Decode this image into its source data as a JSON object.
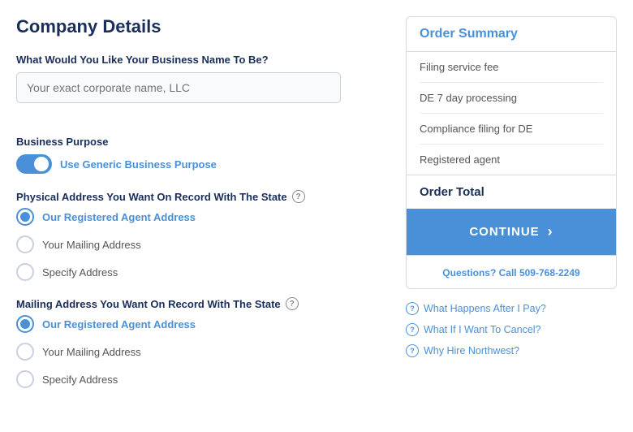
{
  "page": {
    "title": "Company Details"
  },
  "left": {
    "business_name_section": {
      "label": "What Would You Like Your Business Name To Be?",
      "placeholder": "Your exact corporate name, LLC"
    },
    "business_purpose": {
      "label": "Business Purpose",
      "toggle_label": "Use Generic Business Purpose",
      "toggle_on": true
    },
    "physical_address": {
      "label": "Physical Address You Want On Record With The State",
      "has_help": true,
      "options": [
        {
          "label": "Our Registered Agent Address",
          "selected": true
        },
        {
          "label": "Your Mailing Address",
          "selected": false
        },
        {
          "label": "Specify Address",
          "selected": false
        }
      ]
    },
    "mailing_address": {
      "label": "Mailing Address You Want On Record With The State",
      "has_help": true,
      "options": [
        {
          "label": "Our Registered Agent Address",
          "selected": true
        },
        {
          "label": "Your Mailing Address",
          "selected": false
        },
        {
          "label": "Specify Address",
          "selected": false
        }
      ]
    }
  },
  "right": {
    "order_summary": {
      "title": "Order Summary",
      "items": [
        {
          "label": "Filing service fee"
        },
        {
          "label": "DE 7 day processing"
        },
        {
          "label": "Compliance filing for DE"
        },
        {
          "label": "Registered agent"
        }
      ],
      "total_label": "Order Total"
    },
    "continue_button": "CONTINUE",
    "questions_text": "Questions? Call 509-768-2249",
    "faq_links": [
      {
        "label": "What Happens After I Pay?"
      },
      {
        "label": "What If I Want To Cancel?"
      },
      {
        "label": "Why Hire Northwest?"
      }
    ]
  }
}
